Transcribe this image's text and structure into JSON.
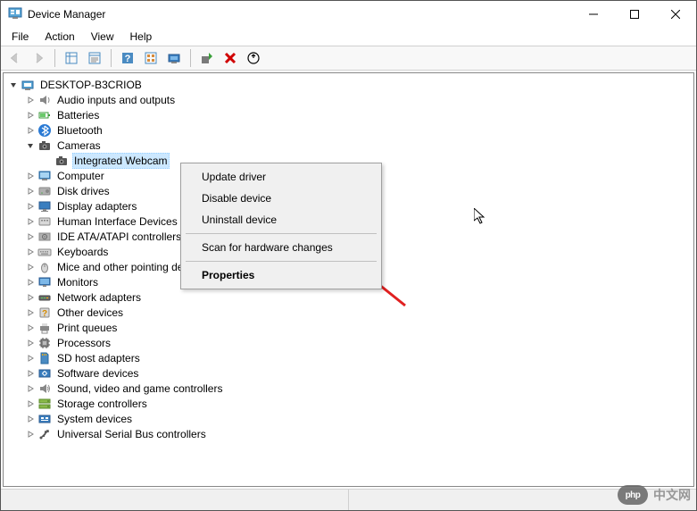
{
  "window": {
    "title": "Device Manager"
  },
  "menu": {
    "file": "File",
    "action": "Action",
    "view": "View",
    "help": "Help"
  },
  "toolbar_icons": {
    "back": "back-icon",
    "forward": "forward-icon",
    "show_hide": "show-hide-tree-icon",
    "properties": "properties-icon",
    "help": "help-icon",
    "action_center": "action-center-icon",
    "scan": "scan-hardware-icon",
    "add": "add-legacy-icon",
    "remove": "remove-icon",
    "update": "update-icon"
  },
  "tree": {
    "root": "DESKTOP-B3CRIOB",
    "items": [
      {
        "label": "Audio inputs and outputs",
        "icon": "audio"
      },
      {
        "label": "Batteries",
        "icon": "battery"
      },
      {
        "label": "Bluetooth",
        "icon": "bluetooth"
      },
      {
        "label": "Cameras",
        "icon": "camera",
        "expanded": true,
        "children": [
          {
            "label": "Integrated Webcam",
            "icon": "camera",
            "selected": true
          }
        ]
      },
      {
        "label": "Computer",
        "icon": "computer"
      },
      {
        "label": "Disk drives",
        "icon": "disk"
      },
      {
        "label": "Display adapters",
        "icon": "display"
      },
      {
        "label": "Human Interface Devices",
        "icon": "hid"
      },
      {
        "label": "IDE ATA/ATAPI controllers",
        "icon": "ide"
      },
      {
        "label": "Keyboards",
        "icon": "keyboard"
      },
      {
        "label": "Mice and other pointing devices",
        "icon": "mouse"
      },
      {
        "label": "Monitors",
        "icon": "monitor"
      },
      {
        "label": "Network adapters",
        "icon": "network"
      },
      {
        "label": "Other devices",
        "icon": "other"
      },
      {
        "label": "Print queues",
        "icon": "printer"
      },
      {
        "label": "Processors",
        "icon": "cpu"
      },
      {
        "label": "SD host adapters",
        "icon": "sd"
      },
      {
        "label": "Software devices",
        "icon": "software"
      },
      {
        "label": "Sound, video and game controllers",
        "icon": "sound"
      },
      {
        "label": "Storage controllers",
        "icon": "storage"
      },
      {
        "label": "System devices",
        "icon": "system"
      },
      {
        "label": "Universal Serial Bus controllers",
        "icon": "usb"
      }
    ]
  },
  "context_menu": {
    "update": "Update driver",
    "disable": "Disable device",
    "uninstall": "Uninstall device",
    "scan": "Scan for hardware changes",
    "properties": "Properties"
  },
  "watermark": {
    "logo": "php",
    "text": "中文网"
  }
}
